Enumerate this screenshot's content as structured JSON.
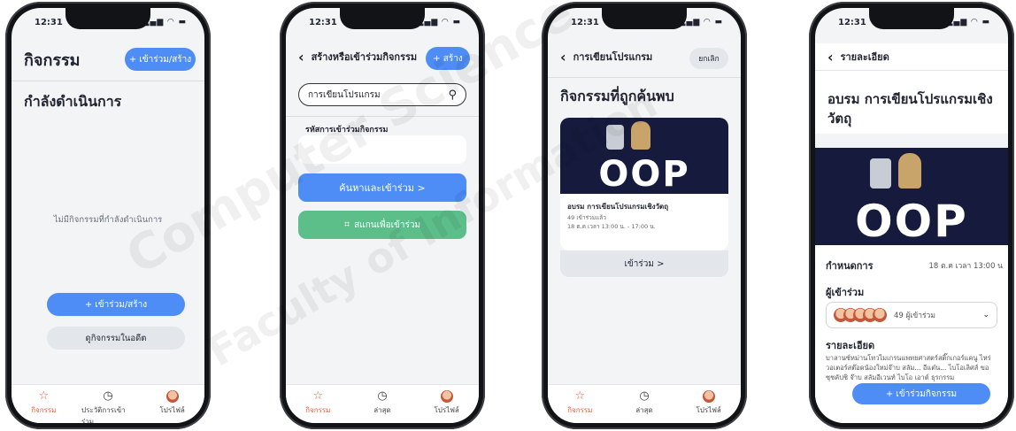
{
  "watermark": {
    "line1": "Computer Science",
    "line2": "Faculty of Information"
  },
  "status": {
    "time": "12:31",
    "icons": "▂▄▆ ◠ ▬"
  },
  "phone1": {
    "title": "กิจกรรม",
    "header_button": "+ เข้าร่วม/สร้าง",
    "section_title": "กำลังดำเนินการ",
    "empty_text": "ไม่มีกิจกรรมที่กำลังดำเนินการ",
    "join_button": "+ เข้าร่วม/สร้าง",
    "past_button": "ดูกิจกรรมในอดีต",
    "tabs": [
      "กิจกรรม",
      "ประวัติการเข้าร่วม",
      "โปรไฟล์"
    ]
  },
  "phone2": {
    "title": "สร้างหรือเข้าร่วมกิจกรรม",
    "header_button": "+ สร้าง",
    "search_value": "การเขียนโปรแกรม",
    "code_label": "รหัสการเข้าร่วมกิจกรรม",
    "code_value": "",
    "search_join_button": "ค้นหาและเข้าร่วม >",
    "scan_button": "สแกนเพื่อเข้าร่วม",
    "tabs": [
      "กิจกรรม",
      "ล่าสุด",
      "โปรไฟล์"
    ]
  },
  "phone3": {
    "title": "การเขียนโปรแกรม",
    "cancel": "ยกเลิก",
    "section_title": "กิจกรรมที่ถูกค้นพบ",
    "cover_word": "OOP",
    "event_title": "อบรม การเขียนโปรแกรมเชิงวัตถุ",
    "joined": "49 เข้าร่วมแล้ว",
    "datetime": "18 ต.ค เวลา 13:00 น. - 17:00 น.",
    "join_button": "เข้าร่วม >",
    "tabs": [
      "กิจกรรม",
      "ล่าสุด",
      "โปรไฟล์"
    ]
  },
  "phone4": {
    "back_title": "รายละเอียด",
    "event_title": "อบรม การเขียนโปรแกรมเชิงวัตถุ",
    "cover_word": "OOP",
    "schedule_label": "กำหนดการ",
    "schedule_value": "18 ต.ค เวลา 13:00 น",
    "participants_label": "ผู้เข้าร่วม",
    "participants_count": "49 ผู้เข้าร่วม",
    "details_label": "รายละเอียด",
    "details_text": "บาลานซ์หม่านโทวไมเกรนแพทยศาสตร์สติ๊กเกอร์แคนู ไหร่วอเตอร์สต๊อคน้องใหม่จ๊าบ สลัม... อีแต๋น... ไบโอเลิศส์ ขอซุชคัปชิ จ๊าบ สลัมอีเวนท์ ไบโอ เอาต์ ธุรกรรม",
    "join_button": "+ เข้าร่วมกิจกรรม"
  },
  "colors": {
    "primary": "#4d8df5",
    "green": "#5cbf8a",
    "active_tab": "#f05a3a",
    "cover_bg": "#161b3d"
  }
}
